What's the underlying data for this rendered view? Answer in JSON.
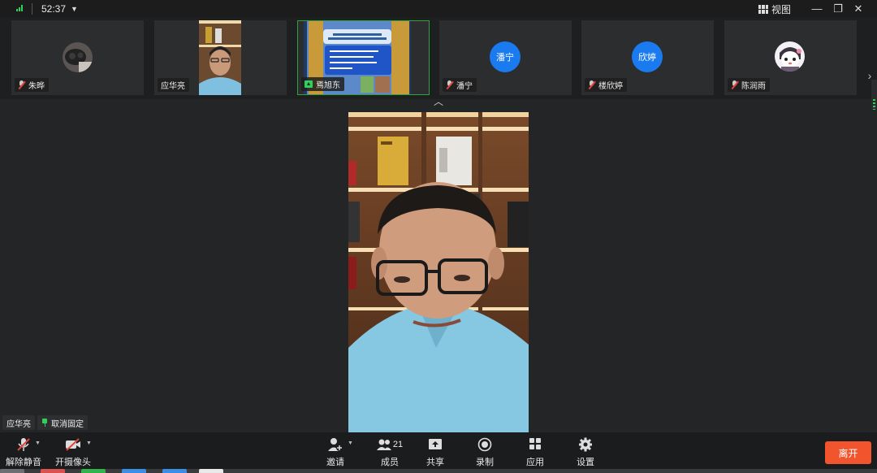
{
  "titlebar": {
    "timer": "52:37",
    "view_label": "视图",
    "minimize_glyph": "—",
    "restore_glyph": "❐",
    "close_glyph": "✕"
  },
  "participants": [
    {
      "name": "朱晔",
      "kind": "photo",
      "muted": true
    },
    {
      "name": "应华亮",
      "kind": "video",
      "muted": false
    },
    {
      "name": "焉旭东",
      "kind": "screen",
      "muted": false,
      "sharing": true
    },
    {
      "name": "潘宁",
      "kind": "initials",
      "initials": "潘宁",
      "muted": true
    },
    {
      "name": "楼欣婷",
      "kind": "initials",
      "initials": "欣婷",
      "muted": true
    },
    {
      "name": "陈润雨",
      "kind": "cartoon",
      "muted": true
    }
  ],
  "main": {
    "speaker_name": "应华亮",
    "unpin_label": "取消固定"
  },
  "toolbar": {
    "unmute_label": "解除静音",
    "camera_label": "开摄像头",
    "invite_label": "邀请",
    "members_label": "成员",
    "members_count": "21",
    "share_label": "共享",
    "record_label": "录制",
    "apps_label": "应用",
    "settings_label": "设置",
    "leave_label": "离开"
  },
  "colors": {
    "accent_green": "#2fd158",
    "avatar_blue": "#1a7af0",
    "leave_red": "#f2542d",
    "muted_red": "#e2453c"
  }
}
